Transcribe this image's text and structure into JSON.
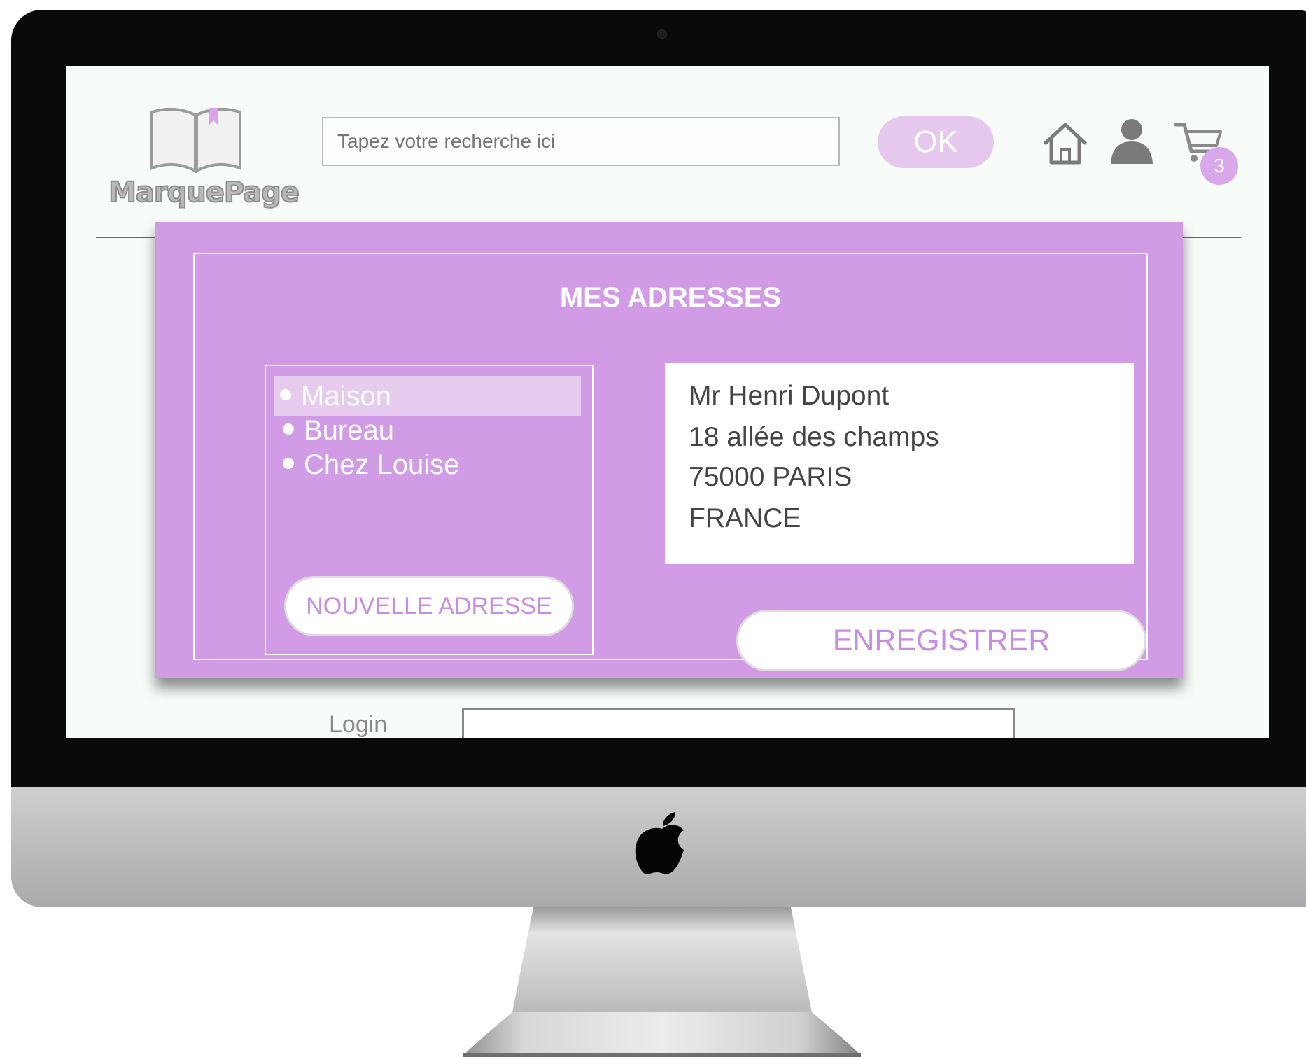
{
  "header": {
    "logo_text": "MarquePage",
    "search_placeholder": "Tapez votre recherche ici",
    "ok_label": "OK",
    "cart_count": "3"
  },
  "background_form": {
    "login_label": "Login"
  },
  "modal": {
    "title": "MES ADRESSES",
    "addresses": [
      {
        "label": "Maison",
        "selected": true
      },
      {
        "label": "Bureau",
        "selected": false
      },
      {
        "label": "Chez Louise",
        "selected": false
      }
    ],
    "new_address_label": "NOUVELLE ADRESSE",
    "address_detail": [
      "Mr Henri Dupont",
      "18 allée des champs",
      "75000 PARIS",
      "FRANCE"
    ],
    "save_label": "ENREGISTRER"
  },
  "colors": {
    "modal_bg": "#d19be6",
    "accent_text": "#c78de0",
    "ok_button": "#e6c8ef",
    "screen_bg": "#f7fcf8"
  },
  "icons": [
    "book-logo-icon",
    "home-icon",
    "user-icon",
    "cart-icon",
    "apple-logo-icon"
  ]
}
